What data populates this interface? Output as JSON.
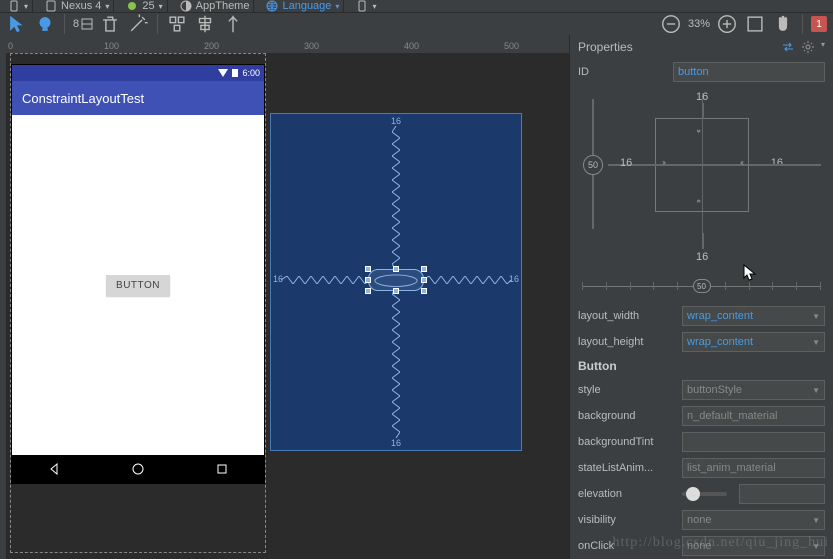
{
  "topbar": {
    "device": "Nexus 4",
    "api": "25",
    "theme": "AppTheme",
    "language": "Language"
  },
  "toolbar": {
    "margin_default": "8",
    "zoom_pct": "33%",
    "warning_count": "1"
  },
  "ruler": {
    "ticks": [
      "0",
      "100",
      "200",
      "300",
      "400",
      "500"
    ]
  },
  "design": {
    "status_time": "6:00",
    "app_title": "ConstraintLayoutTest",
    "button_label": "BUTTON"
  },
  "blueprint": {
    "margin_top": "16",
    "margin_bottom": "16",
    "margin_left": "16",
    "margin_right": "16"
  },
  "properties": {
    "panel_title": "Properties",
    "id_label": "ID",
    "id_value": "button",
    "constraints": {
      "margin_top": "16",
      "margin_bottom": "16",
      "margin_left": "16",
      "margin_right": "16",
      "vertical_bias": "50",
      "horizontal_bias": "50"
    },
    "layout_width": {
      "label": "layout_width",
      "value": "wrap_content"
    },
    "layout_height": {
      "label": "layout_height",
      "value": "wrap_content"
    },
    "button_section": "Button",
    "style": {
      "label": "style",
      "value": "buttonStyle"
    },
    "background": {
      "label": "background",
      "value": "n_default_material"
    },
    "backgroundTint": {
      "label": "backgroundTint",
      "value": ""
    },
    "stateListAnimator": {
      "label": "stateListAnim...",
      "value": "list_anim_material"
    },
    "elevation": {
      "label": "elevation",
      "value": ""
    },
    "visibility": {
      "label": "visibility",
      "value": "none"
    },
    "onClick": {
      "label": "onClick",
      "value": "none"
    }
  },
  "watermark": "http://blog.csdn.net/qiu_jing_hui"
}
